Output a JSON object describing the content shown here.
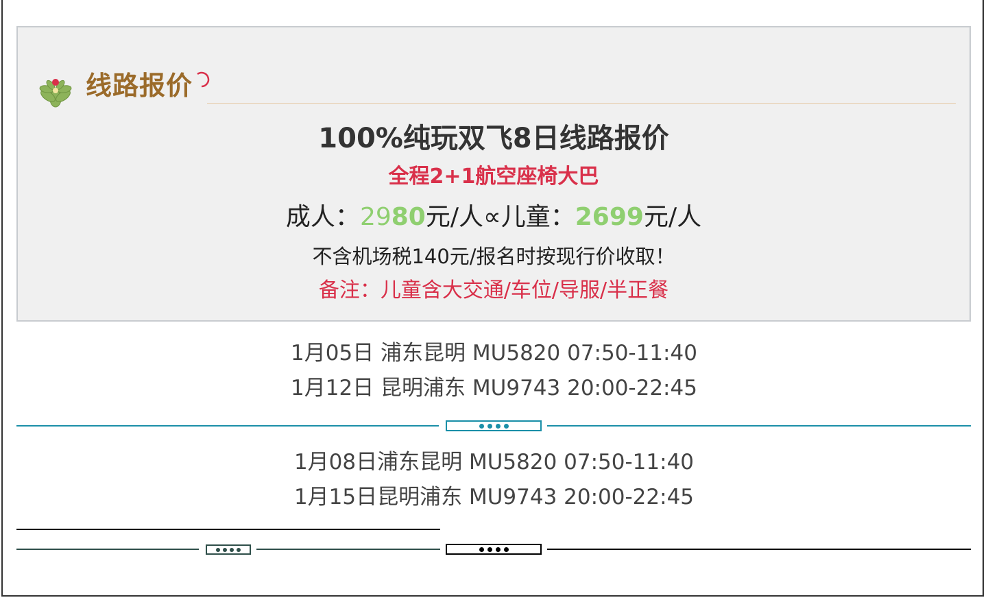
{
  "section": {
    "icon": "flower-icon",
    "title": "线路报价"
  },
  "price_box": {
    "route_title": "100%纯玩双飞8日线路报价",
    "bus_note": "全程2+1航空座椅大巴",
    "adult_label": "成人：",
    "adult_price_a": "29",
    "adult_price_b": "80",
    "adult_unit": "元/人",
    "separator": "∝",
    "child_label": "儿童：",
    "child_price": "2699",
    "child_unit": "元/人",
    "tax_note": "不含机场税140元/报名时按现行价收取！",
    "remark": "备注：儿童含大交通/车位/导服/半正餐"
  },
  "flights_group_1": [
    "1月05日 浦东昆明 MU5820 07:50-11:40",
    "1月12日 昆明浦东 MU9743 20:00-22:45"
  ],
  "flights_group_2": [
    "1月08日浦东昆明 MU5820 07:50-11:40",
    "1月15日昆明浦东 MU9743 20:00-22:45"
  ],
  "colors": {
    "title_brown": "#9b6b2a",
    "accent_red": "#d9304a",
    "price_green": "#8fcf70",
    "divider_teal": "#1a8fa8",
    "divider_dark_green": "#2f4f4a",
    "divider_black": "#000000"
  }
}
